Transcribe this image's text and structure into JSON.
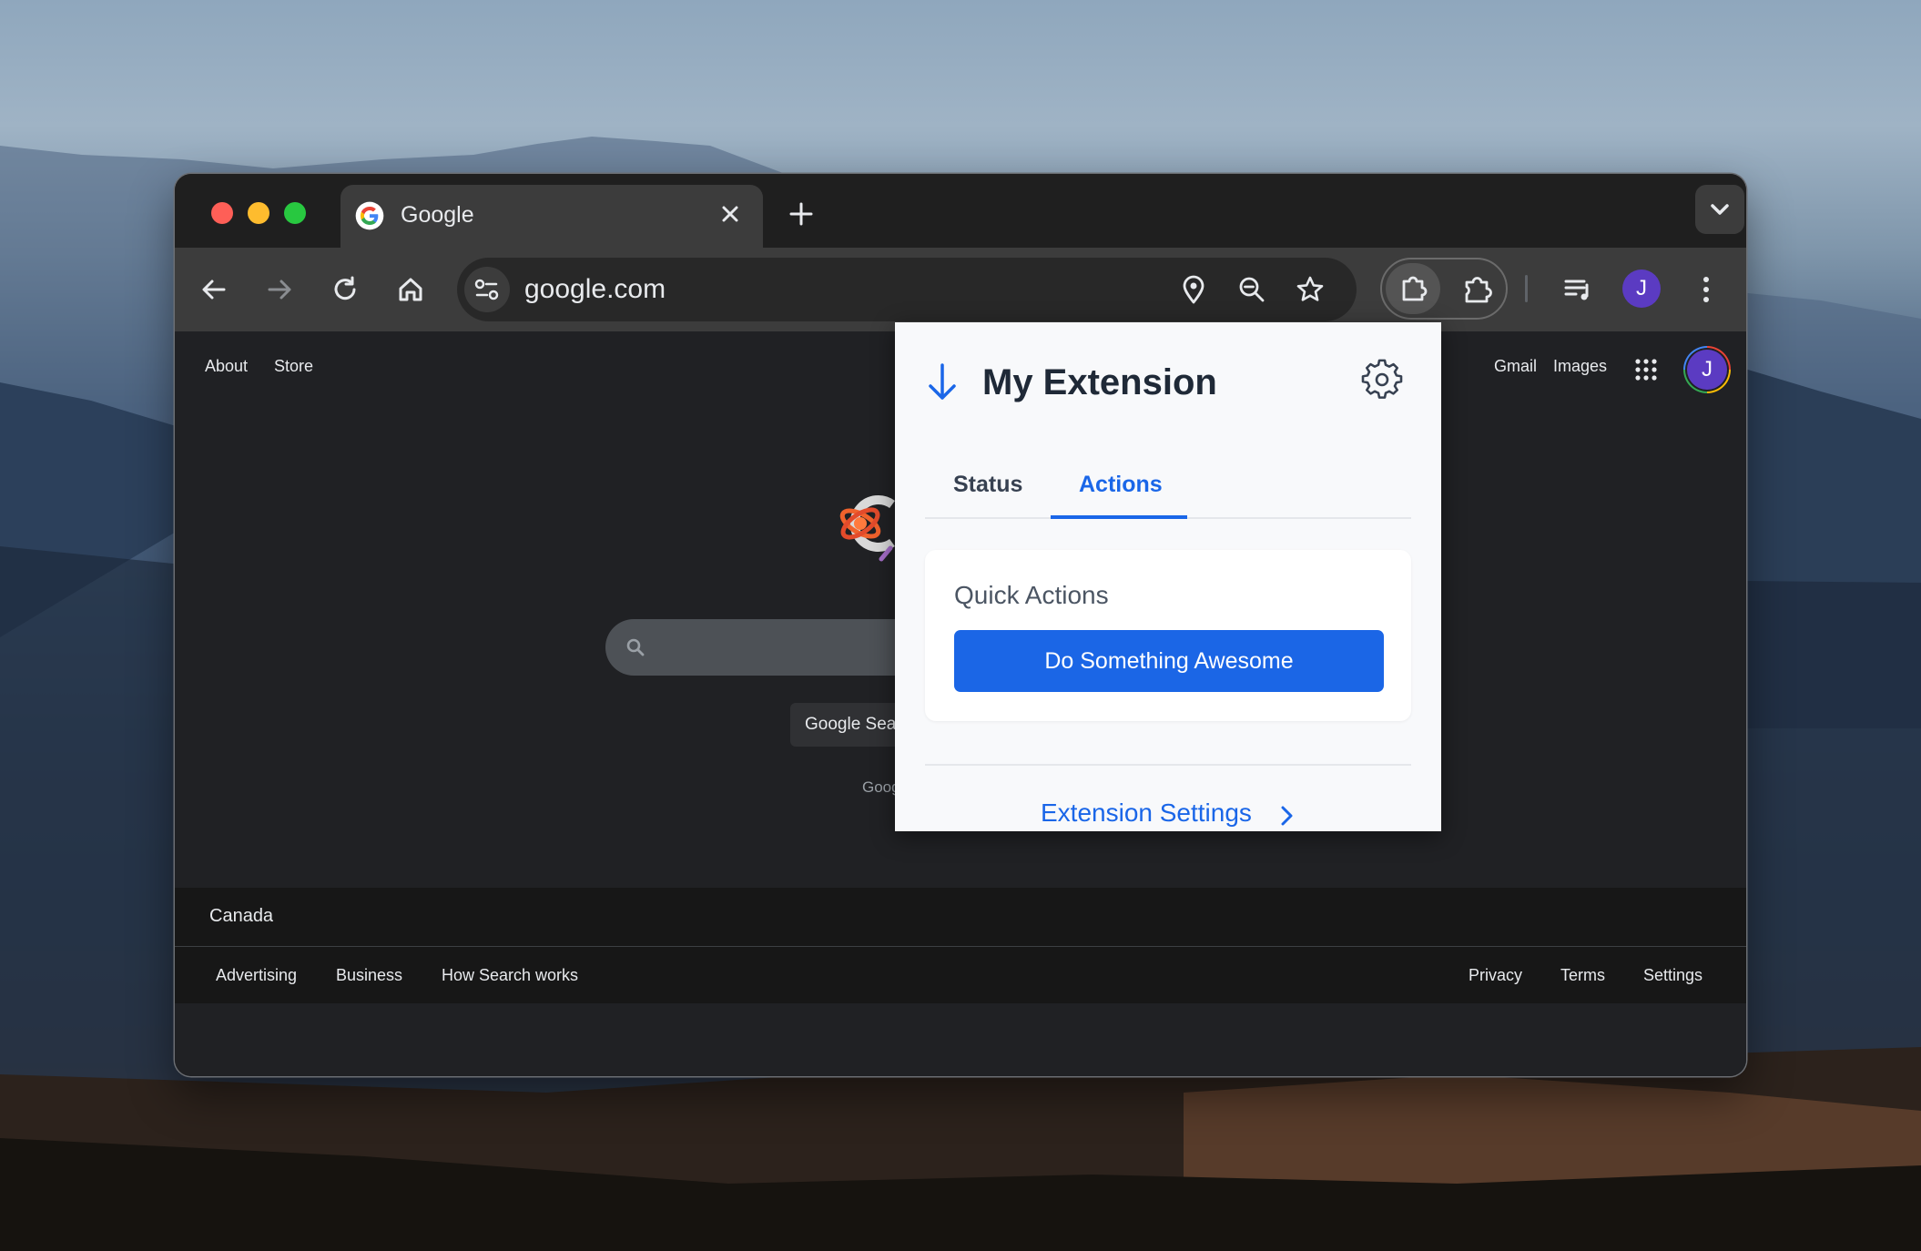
{
  "tab": {
    "title": "Google",
    "favicon": "google-g-icon",
    "close_icon": "close-icon"
  },
  "toolbar": {
    "url": "google.com",
    "icons": [
      "back-arrow-icon",
      "forward-arrow-icon",
      "reload-icon",
      "home-icon",
      "site-tune-icon",
      "location-pin-icon",
      "zoom-out-icon",
      "bookmark-star-icon",
      "extension-puzzle-icon",
      "extensions-icon",
      "media-control-icon",
      "more-vert-icon"
    ],
    "profile_initial": "J"
  },
  "google": {
    "top_left_links": [
      "About",
      "Store"
    ],
    "top_right_links": [
      "Gmail",
      "Images"
    ],
    "profile_initial": "J",
    "search_button": "Google Sea",
    "offered_text": "Goog",
    "footer_country": "Canada",
    "footer_left": [
      "Advertising",
      "Business",
      "How Search works"
    ],
    "footer_right": [
      "Privacy",
      "Terms",
      "Settings"
    ]
  },
  "popup": {
    "title": "My Extension",
    "tabs": [
      "Status",
      "Actions"
    ],
    "active_tab": "Actions",
    "card_title": "Quick Actions",
    "primary_button": "Do Something Awesome",
    "settings_link": "Extension Settings",
    "accent_color": "#1a66e8"
  },
  "colors": {
    "window_bg": "#202124",
    "toolbar_bg": "#3c3c3c",
    "traffic_red": "#fe5f57",
    "traffic_yellow": "#febc2e",
    "traffic_green": "#28c840"
  }
}
